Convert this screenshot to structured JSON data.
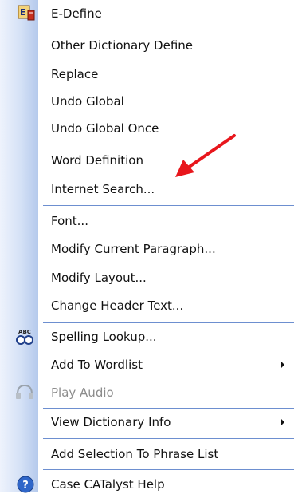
{
  "menu": {
    "items": [
      {
        "label": "E-Define",
        "icon": "e-define-icon"
      },
      {
        "label": "Other Dictionary Define"
      },
      {
        "label": "Replace"
      },
      {
        "label": "Undo Global"
      },
      {
        "label": "Undo Global Once"
      },
      {
        "label": "Word Definition"
      },
      {
        "label": "Internet Search..."
      },
      {
        "label": "Font..."
      },
      {
        "label": "Modify Current Paragraph..."
      },
      {
        "label": "Modify Layout..."
      },
      {
        "label": "Change Header Text..."
      },
      {
        "label": "Spelling Lookup...",
        "icon": "spelling-icon"
      },
      {
        "label": "Add To Wordlist",
        "submenu": true
      },
      {
        "label": "Play Audio",
        "icon": "headphones-icon",
        "disabled": true
      },
      {
        "label": "View Dictionary Info",
        "submenu": true
      },
      {
        "label": "Add Selection To Phrase List"
      },
      {
        "label": "Case CATalyst Help",
        "icon": "help-icon"
      }
    ],
    "icon_text": {
      "spelling": "ABC"
    }
  },
  "colors": {
    "annotation_arrow": "#e8161c",
    "separator": "#6d8fd0",
    "gutter": "#c8d8f3"
  }
}
